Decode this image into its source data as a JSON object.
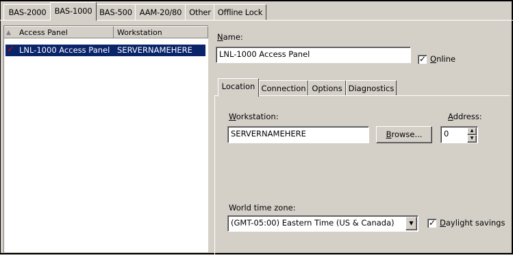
{
  "top_tabs": [
    "BAS-2000",
    "BAS-1000",
    "BAS-500",
    "AAM-20/80",
    "Other",
    "Offline Lock"
  ],
  "list": {
    "columns": [
      "Access Panel",
      "Workstation"
    ],
    "rows": [
      {
        "panel": "LNL-1000 Access Panel",
        "workstation": "SERVERNAMEHERE"
      }
    ]
  },
  "form": {
    "name_label": "Name:",
    "name_value": "LNL-1000 Access Panel",
    "online_label": "Online",
    "online_checked": true
  },
  "inner_tabs": [
    "Location",
    "Connection",
    "Options",
    "Diagnostics"
  ],
  "location": {
    "workstation_label": "Workstation:",
    "workstation_value": "SERVERNAMEHERE",
    "browse_label": "Browse...",
    "address_label": "Address:",
    "address_value": "0",
    "timezone_label": "World time zone:",
    "timezone_value": "(GMT-05:00) Eastern Time (US & Canada)",
    "daylight_label": "Daylight savings",
    "daylight_checked": true
  },
  "colors": {
    "selection": "#0a246a",
    "face": "#d4d0c8"
  }
}
